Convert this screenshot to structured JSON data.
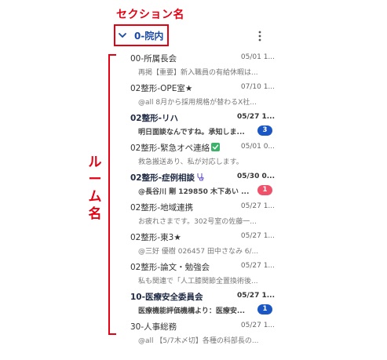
{
  "annotations": {
    "section_label": "セクション名",
    "room_label": [
      "ル",
      "ー",
      "ム",
      "名"
    ]
  },
  "section": {
    "name": "0-院内",
    "chevron_icon": "chevron-down-icon",
    "more_icon": "more-vertical-icon"
  },
  "rooms": [
    {
      "name": "00-所属長会",
      "time": "05/01 1...",
      "preview": "再掲【重要】新入職員の有給休暇は...",
      "unread": false
    },
    {
      "name": "02整形-OPE室★",
      "time": "07/10 1...",
      "preview": "@all 8月から採用規格が替わるX社...",
      "unread": false
    },
    {
      "name": "02整形-リハ",
      "time": "05/27 1...",
      "preview": "明日面談なんですね。承知しま...",
      "unread": true,
      "badge": "3",
      "badge_color": "#1a56c4"
    },
    {
      "name": "02整形-緊急オペ連絡",
      "time": "05/01 0...",
      "preview": "救急搬送あり、私が対応します。",
      "unread": false,
      "icon": "check-box-icon"
    },
    {
      "name": "02整形-症例相談",
      "time": "05/30 0...",
      "preview": "@長谷川 剛 129850 木下あい ...",
      "unread": true,
      "badge": "1",
      "badge_color": "#f0516a",
      "icon": "stethoscope-icon"
    },
    {
      "name": "02整形-地域連携",
      "time": "05/27 1...",
      "preview": "お疲れさまです。302号室の佐藤一...",
      "unread": false
    },
    {
      "name": "02整形-東3★",
      "time": "05/27 1...",
      "preview": "@三好 優樹 026457 田中さなみ  6/...",
      "unread": false
    },
    {
      "name": "02整形-論文・勉強会",
      "time": "05/27 1...",
      "preview": "私も関連で「人工膝関節全置換術後...",
      "unread": false
    },
    {
      "name": "10-医療安全委員会",
      "time": "05/27 1...",
      "preview": "医療機能評価機構より：医療安...",
      "unread": true,
      "badge": "1",
      "badge_color": "#1a56c4"
    },
    {
      "name": "30-人事総務",
      "time": "05/27 1...",
      "preview": "@all 【5/7木〆切】各種の科部長の...",
      "unread": false
    }
  ]
}
